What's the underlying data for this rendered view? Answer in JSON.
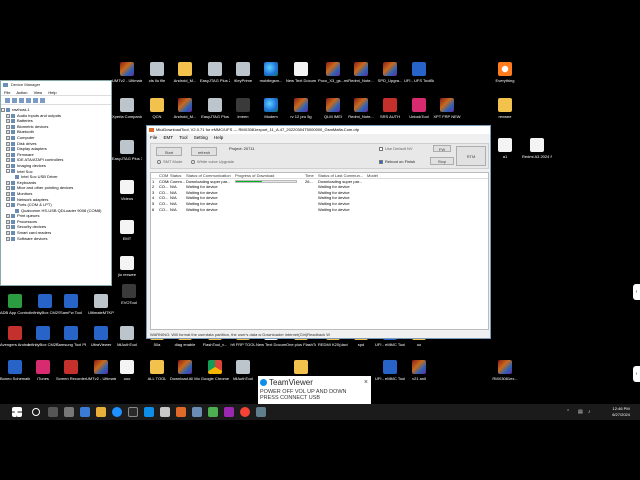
{
  "desktop": {
    "icons_row1": [
      "UMTv2 - UltimateMTK2",
      "cts llo file",
      "Android_M...",
      "EasyJTAG Plus 2",
      "iKeyPrime",
      "mobilegsm...",
      "New Text Document",
      "Poco_X3_gs...mi_account...",
      "Redmi_Note...",
      "SPD_Upgra...",
      "UFI - UFS ToolBox",
      "Everything"
    ],
    "icons_row2": [
      "Xperia Companion",
      "QCN",
      "Android_M...",
      "EasyJTAG Plus",
      "imeen",
      "Modem",
      "rv 12 pro 5g",
      "QLM IMEI",
      "Redmi_Note...",
      "SRS AUTH",
      "UnlockTool",
      "XPT FRP NEW",
      "rexwee"
    ],
    "icons_col_left": [
      "EasyJTAG Plus 3PRP Flasher",
      "Videos",
      "EMT",
      "jio rexwee"
    ],
    "icons_right": [
      "a1",
      "Redmi A3 2024 Produ..."
    ],
    "icons_row3": [
      "ADB App Control",
      "InfinityBox CM2SCR",
      "SamFw Tool",
      "UltimateMTKP",
      "EVOTool"
    ],
    "icons_row4": [
      "Avengers Android MTK",
      "InfinityBox CM2SPD",
      "Samsung Tool PRO",
      "UltraViewer",
      "MiAuthTool",
      "50a",
      "dlag enable",
      "FlashTool_v...",
      "hfl FRP TOOL",
      "New Text Document (4)",
      "One plus FlashTool_v...",
      "REDMI K20(davinci...",
      "spd",
      "UFI - eMMC ToolBox",
      "oo"
    ],
    "icons_row5": [
      "Boneo Schematics",
      "iTunes",
      "Screen Recorder",
      "UMTv2 - UltimateMTK2",
      "ooo",
      "ALL TOOL",
      "Download All Mobile Drive...",
      "Google Chrome",
      "MiAuthTool",
      "FlashTool_v...",
      "UFI - eMMC ToolBox",
      "v21 anil",
      "RMX3081ex..."
    ]
  },
  "device_manager": {
    "title": "Device Manager",
    "menu": [
      "File",
      "Action",
      "View",
      "Help"
    ],
    "root": "ravihost-1",
    "items": [
      {
        "label": "Audio inputs and outputs",
        "expanded": false,
        "level": 1
      },
      {
        "label": "Batteries",
        "expanded": false,
        "level": 1
      },
      {
        "label": "Biometric devices",
        "expanded": false,
        "level": 1
      },
      {
        "label": "Bluetooth",
        "expanded": false,
        "level": 1
      },
      {
        "label": "Computer",
        "expanded": false,
        "level": 1
      },
      {
        "label": "Disk drives",
        "expanded": false,
        "level": 1
      },
      {
        "label": "Display adapters",
        "expanded": false,
        "level": 1
      },
      {
        "label": "Firmware",
        "expanded": false,
        "level": 1
      },
      {
        "label": "IDE ATA/ATAPI controllers",
        "expanded": false,
        "level": 1
      },
      {
        "label": "Imaging devices",
        "expanded": false,
        "level": 1
      },
      {
        "label": "Intel Soc",
        "expanded": true,
        "level": 1
      },
      {
        "label": "Intel Soc USB Driver",
        "expanded": false,
        "level": 2
      },
      {
        "label": "Keyboards",
        "expanded": false,
        "level": 1
      },
      {
        "label": "Mice and other pointing devices",
        "expanded": false,
        "level": 1
      },
      {
        "label": "Monitors",
        "expanded": false,
        "level": 1
      },
      {
        "label": "Network adapters",
        "expanded": false,
        "level": 1
      },
      {
        "label": "Ports (COM & LPT)",
        "expanded": true,
        "level": 1
      },
      {
        "label": "Qualcomm HS-USB QDLoader 9008 (COM8)",
        "expanded": false,
        "level": 2
      },
      {
        "label": "Print queues",
        "expanded": false,
        "level": 1
      },
      {
        "label": "Processors",
        "expanded": false,
        "level": 1
      },
      {
        "label": "Security devices",
        "expanded": false,
        "level": 1
      },
      {
        "label": "Smart card readers",
        "expanded": false,
        "level": 1
      },
      {
        "label": "Software devices",
        "expanded": false,
        "level": 1
      }
    ]
  },
  "flash_tool": {
    "title": "MiuiDownloadTool, V2.0.71 for eMMC/UFS --- RMX3081export_11_A.47_20220304T5000000_GsmMafia.Com.ofp",
    "menu": [
      "File",
      "EMT",
      "Tool",
      "Setting",
      "Help"
    ],
    "start_label": "Start",
    "refresh_label": "refresh",
    "project_label": "Project: 20711",
    "stop_label": "Stop",
    "restart_label": "Restart",
    "fw_label": "FW",
    "rtm_label": "RTM",
    "smt_mode_label": "SMT Mode",
    "white_space_label": "White voice Upgrade",
    "use_default_label": "Use Default NV",
    "reboot_label": "Reboot on Finish",
    "columns": [
      "",
      "COM",
      "Status",
      "Status of Communication",
      "Progress of Download",
      "Time",
      "Status of Last Commun...",
      "Model"
    ],
    "rows": [
      {
        "no": "1",
        "com": "COM8",
        "status": "Comm...",
        "comm": "Downloading super par...",
        "progress": 0.44,
        "time": "26...",
        "last": "Downloading super par..."
      },
      {
        "no": "2",
        "com": "CO...",
        "status": "N/A",
        "comm": "Waiting for device",
        "progress": 0,
        "time": "",
        "last": "Waiting for device"
      },
      {
        "no": "3",
        "com": "CO...",
        "status": "N/A",
        "comm": "Waiting for device",
        "progress": 0,
        "time": "",
        "last": "Waiting for device"
      },
      {
        "no": "4",
        "com": "CO...",
        "status": "N/A",
        "comm": "Waiting for device",
        "progress": 0,
        "time": "",
        "last": "Waiting for device"
      },
      {
        "no": "5",
        "com": "CO...",
        "status": "N/A",
        "comm": "Waiting for device",
        "progress": 0,
        "time": "",
        "last": "Waiting for device"
      },
      {
        "no": "6",
        "com": "CO...",
        "status": "N/A",
        "comm": "Waiting for device",
        "progress": 0,
        "time": "",
        "last": "Waiting for device"
      }
    ],
    "status_bar": "WARNING: Will format the userdata partition, the user's data w  Downloader internet(Ctrl)Readback W"
  },
  "teamviewer": {
    "brand": "TeamViewer",
    "close": "×",
    "line1": "POWER OFF  VOL UP AND DOWN",
    "line2": "PRESS CONNECT USB"
  },
  "taskbar": {
    "time": "12:46 PM",
    "date": "6/27/2024"
  }
}
